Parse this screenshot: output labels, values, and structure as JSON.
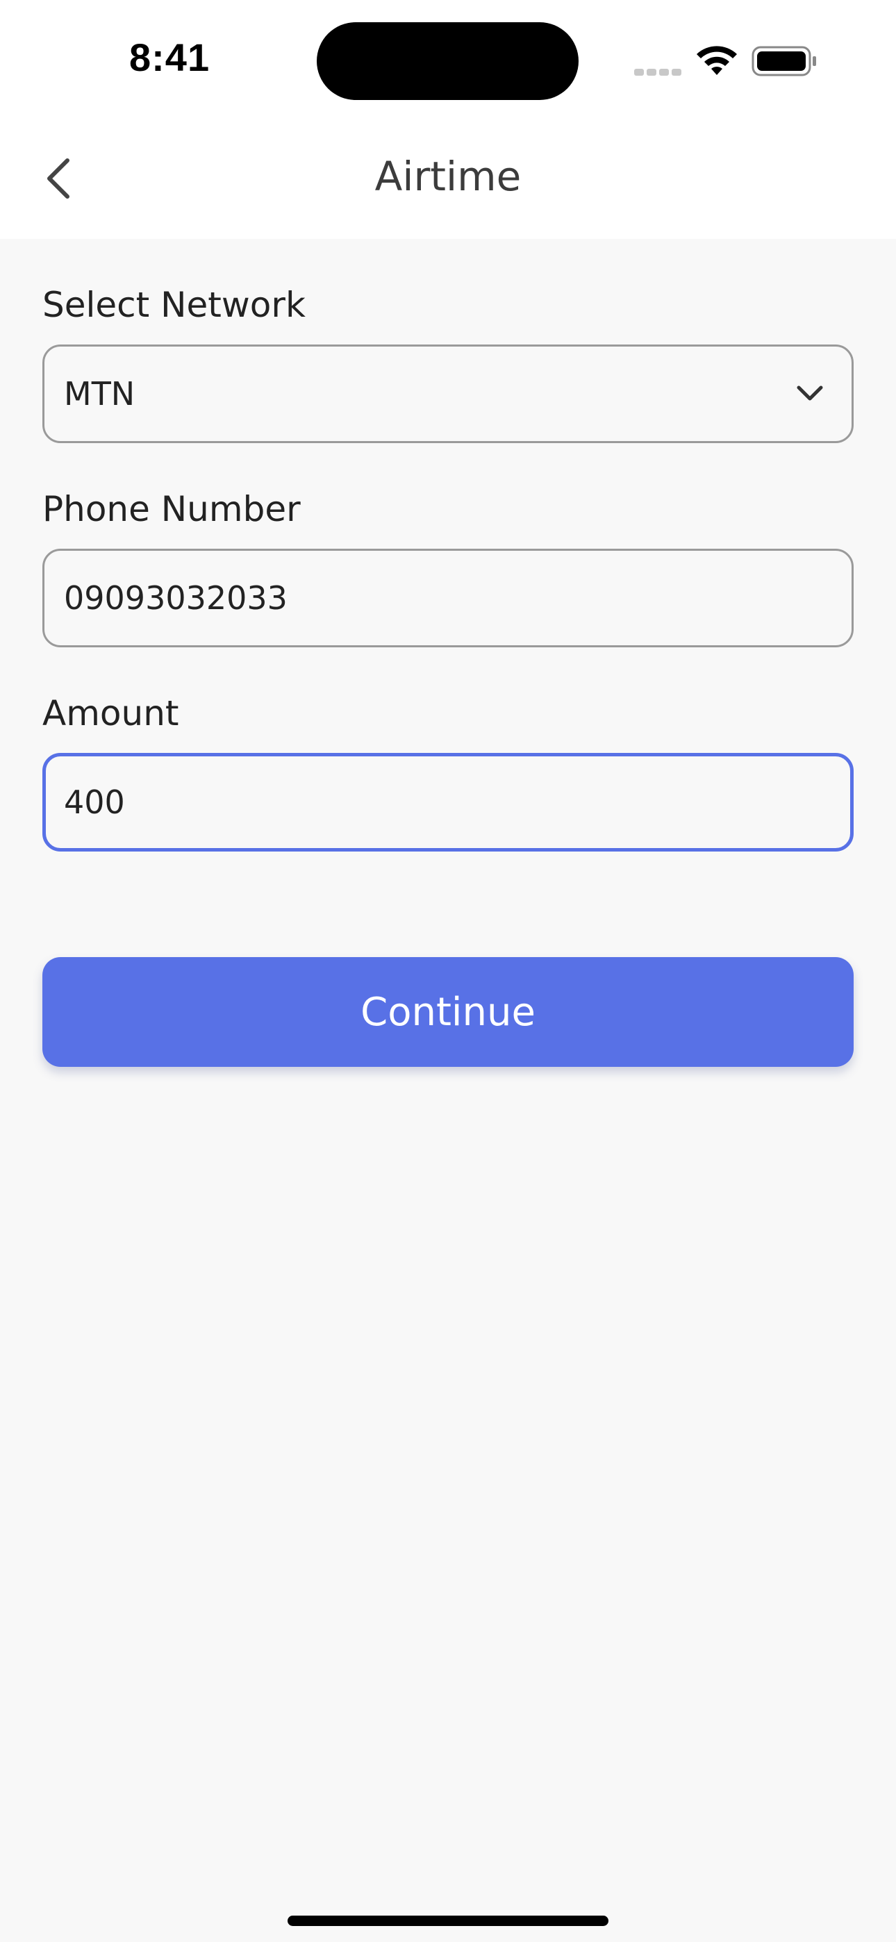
{
  "status_bar": {
    "time": "8:41",
    "icons": [
      "signal-icon",
      "wifi-icon",
      "battery-icon"
    ]
  },
  "header": {
    "back_icon": "chevron-left-icon",
    "title": "Airtime"
  },
  "form": {
    "network": {
      "label": "Select Network",
      "value": "MTN",
      "icon": "chevron-down-icon"
    },
    "phone": {
      "label": "Phone Number",
      "value": "09093032033"
    },
    "amount": {
      "label": "Amount",
      "value": "400"
    }
  },
  "actions": {
    "continue_label": "Continue"
  },
  "colors": {
    "accent": "#5871e6",
    "background": "#f8f8f8",
    "field_border": "#9a9a9a"
  }
}
